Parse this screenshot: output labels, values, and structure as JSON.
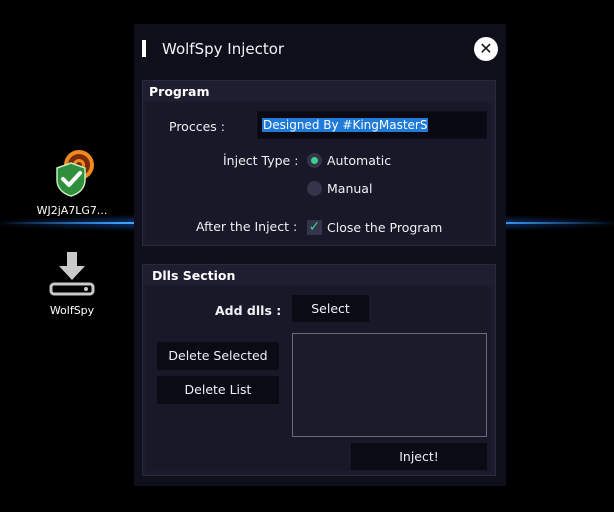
{
  "desktop": {
    "icons": [
      {
        "label": "WJ2jA7LG7..."
      },
      {
        "label": "WolfSpy"
      }
    ]
  },
  "window": {
    "title": "WolfSpy Injector",
    "close_glyph": "✕"
  },
  "program": {
    "section_title": "Program",
    "process_label": "Procces :",
    "process_value": "Designed By #KingMasterS",
    "inject_type_label": "İnject Type :",
    "options": [
      {
        "label": "Automatic",
        "selected": true
      },
      {
        "label": "Manual",
        "selected": false
      }
    ],
    "after_inject_label": "After the Inject :",
    "close_program": {
      "label": "Close the Program",
      "checked": true
    }
  },
  "dlls": {
    "section_title": "Dlls Section",
    "add_label": "Add dlls :",
    "select_button": "Select",
    "delete_selected_button": "Delete Selected",
    "delete_list_button": "Delete List",
    "inject_button": "Inject!"
  },
  "colors": {
    "accent": "#3ccf8e",
    "selection": "#1f7ad8",
    "window_bg": "#10101c"
  }
}
